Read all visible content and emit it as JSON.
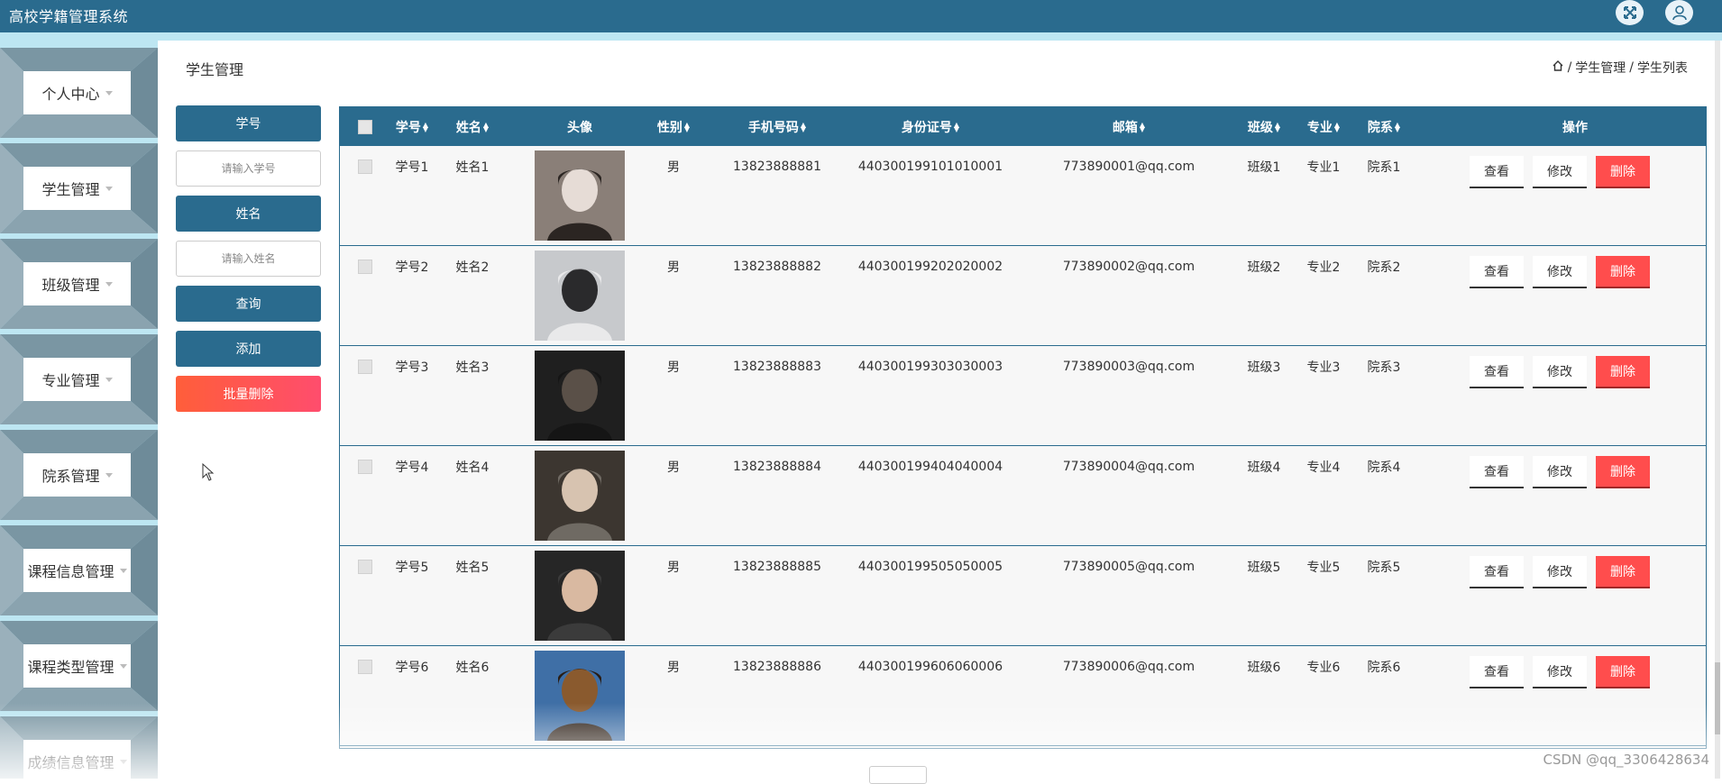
{
  "app": {
    "title": "高校学籍管理系统"
  },
  "topbar_icons": [
    "fullscreen-icon",
    "user-icon"
  ],
  "sidebar": {
    "items": [
      {
        "label": "个人中心"
      },
      {
        "label": "学生管理"
      },
      {
        "label": "班级管理"
      },
      {
        "label": "专业管理"
      },
      {
        "label": "院系管理"
      },
      {
        "label": "课程信息管理"
      },
      {
        "label": "课程类型管理"
      },
      {
        "label": "成绩信息管理"
      }
    ]
  },
  "page": {
    "title": "学生管理"
  },
  "breadcrumb": {
    "home_icon": "home-icon",
    "level1": "学生管理",
    "sep": "/",
    "level2": "学生列表"
  },
  "search": {
    "student_no_label": "学号",
    "student_no_placeholder": "请输入学号",
    "name_label": "姓名",
    "name_placeholder": "请输入姓名",
    "query_label": "查询",
    "add_label": "添加",
    "batch_delete_label": "批量删除"
  },
  "table": {
    "headers": {
      "student_no": "学号",
      "name": "姓名",
      "avatar": "头像",
      "gender": "性别",
      "phone": "手机号码",
      "id_card": "身份证号",
      "email": "邮箱",
      "class": "班级",
      "major": "专业",
      "department": "院系",
      "actions": "操作"
    },
    "rows": [
      {
        "student_no": "学号1",
        "name": "姓名1",
        "gender": "男",
        "phone": "13823888881",
        "id_card": "440300199101010001",
        "email": "773890001@qq.com",
        "class": "班级1",
        "major": "专业1",
        "department": "院系1"
      },
      {
        "student_no": "学号2",
        "name": "姓名2",
        "gender": "男",
        "phone": "13823888882",
        "id_card": "440300199202020002",
        "email": "773890002@qq.com",
        "class": "班级2",
        "major": "专业2",
        "department": "院系2"
      },
      {
        "student_no": "学号3",
        "name": "姓名3",
        "gender": "男",
        "phone": "13823888883",
        "id_card": "440300199303030003",
        "email": "773890003@qq.com",
        "class": "班级3",
        "major": "专业3",
        "department": "院系3"
      },
      {
        "student_no": "学号4",
        "name": "姓名4",
        "gender": "男",
        "phone": "13823888884",
        "id_card": "440300199404040004",
        "email": "773890004@qq.com",
        "class": "班级4",
        "major": "专业4",
        "department": "院系4"
      },
      {
        "student_no": "学号5",
        "name": "姓名5",
        "gender": "男",
        "phone": "13823888885",
        "id_card": "440300199505050005",
        "email": "773890005@qq.com",
        "class": "班级5",
        "major": "专业5",
        "department": "院系5"
      },
      {
        "student_no": "学号6",
        "name": "姓名6",
        "gender": "男",
        "phone": "13823888886",
        "id_card": "440300199606060006",
        "email": "773890006@qq.com",
        "class": "班级6",
        "major": "专业6",
        "department": "院系6"
      }
    ],
    "actions": {
      "view": "查看",
      "edit": "修改",
      "delete": "删除"
    }
  },
  "watermark": "CSDN @qq_3306428634",
  "colors": {
    "primary": "#2a6b8e",
    "sidebar_bg": "#bde6f2",
    "danger": "#ff4d4d",
    "batch_delete": "#ff5e3a"
  }
}
